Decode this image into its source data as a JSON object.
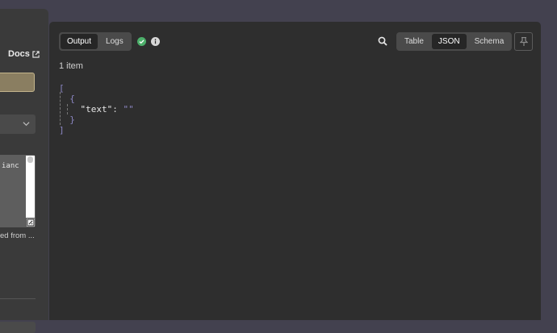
{
  "left_panel": {
    "docs_label": "Docs",
    "textarea_value": "ianc",
    "hint_text": "ed from ..."
  },
  "output_tabs": [
    {
      "label": "Output",
      "active": true
    },
    {
      "label": "Logs",
      "active": false
    }
  ],
  "view_tabs": [
    {
      "label": "Table",
      "active": false
    },
    {
      "label": "JSON",
      "active": true
    },
    {
      "label": "Schema",
      "active": false
    }
  ],
  "status_icons": [
    "check-circle-icon",
    "info-icon"
  ],
  "item_count": "1 item",
  "json": {
    "open_array": "[",
    "open_object": "{",
    "key": "\"text\"",
    "colon": ":",
    "value": "\"\"",
    "close_object": "}",
    "close_array": "]"
  },
  "colors": {
    "background": "#43414f",
    "panel": "#2e2e2e",
    "success": "#4caf6a",
    "json_punctuation": "#8c87c4"
  }
}
